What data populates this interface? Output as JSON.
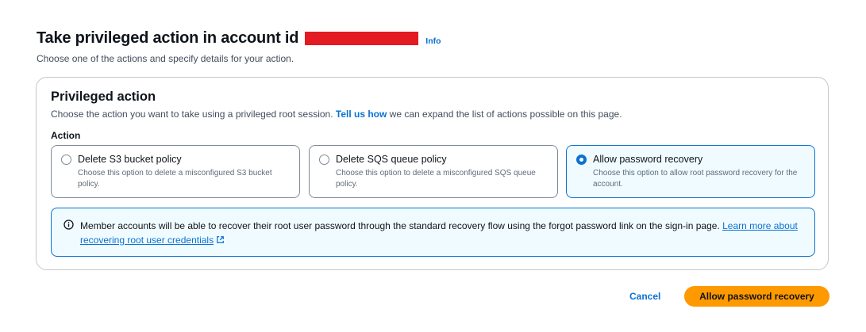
{
  "header": {
    "title": "Take privileged action in account id",
    "info_link": "Info",
    "description": "Choose one of the actions and specify details for your action."
  },
  "section": {
    "title": "Privileged action",
    "description_before": "Choose the action you want to take using a privileged root session. ",
    "description_link": "Tell us how",
    "description_after": " we can expand the list of actions possible on this page.",
    "action_label": "Action"
  },
  "actions": [
    {
      "label": "Delete S3 bucket policy",
      "description": "Choose this option to delete a misconfigured S3 bucket policy.",
      "selected": false
    },
    {
      "label": "Delete SQS queue policy",
      "description": "Choose this option to delete a misconfigured SQS queue policy.",
      "selected": false
    },
    {
      "label": "Allow password recovery",
      "description": "Choose this option to allow root password recovery for the account.",
      "selected": true
    }
  ],
  "alert": {
    "text": "Member accounts will be able to recover their root user password through the standard recovery flow using the forgot password link on the sign-in page. ",
    "link": "Learn more about recovering root user credentials"
  },
  "footer": {
    "cancel_label": "Cancel",
    "primary_label": "Allow password recovery"
  },
  "colors": {
    "accent": "#0972d3",
    "primary_button": "#ff9900",
    "redaction": "#e31b23"
  },
  "icons": {
    "alert": "info-circle-icon",
    "link": "external-link-icon"
  }
}
